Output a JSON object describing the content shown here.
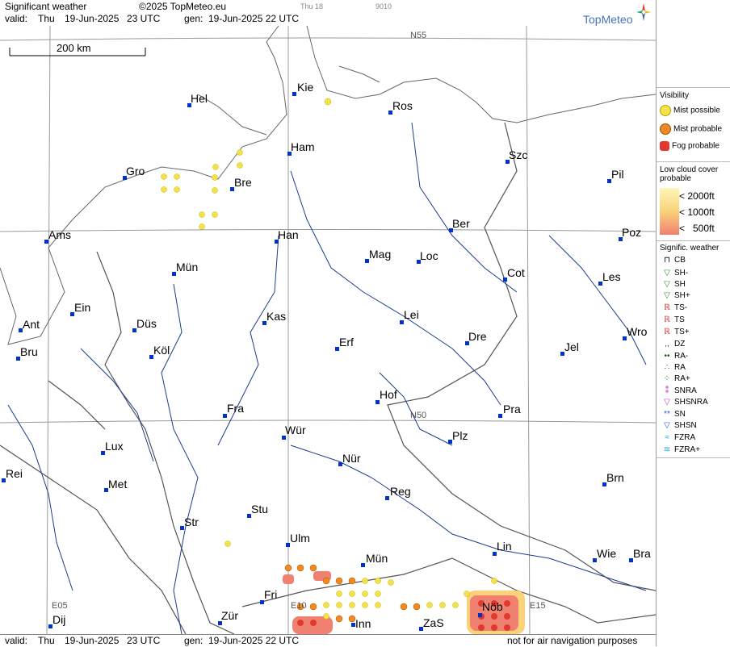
{
  "header": {
    "title": "Significant weather",
    "copyright": "©2025 TopMeteo.eu",
    "valid_label": "valid:",
    "valid_day": "Thu",
    "valid_date": "19-Jun-2025",
    "valid_time": "23 UTC",
    "gen_label": "gen:",
    "gen_value": "19-Jun-2025 22 UTC",
    "small_code_1": "Thu 18",
    "small_code_2": "9010",
    "brand": "TopMeteo"
  },
  "footer": {
    "valid_label": "valid:",
    "valid_day": "Thu",
    "valid_date": "19-Jun-2025",
    "valid_time": "23 UTC",
    "gen_label": "gen:",
    "gen_value": "19-Jun-2025 22 UTC",
    "disclaimer": "not for air navigation purposes"
  },
  "map": {
    "scale_label": "200 km",
    "grid_labels": {
      "n55": "N55",
      "n50": "N50",
      "e05": "E05",
      "e10": "E10",
      "e15": "E15"
    },
    "cities": [
      "Hel",
      "Kie",
      "Ros",
      "Ham",
      "Szc",
      "Gro",
      "Bre",
      "Pil",
      "Ber",
      "Ams",
      "Han",
      "Poz",
      "Mag",
      "Loc",
      "Mün",
      "Cot",
      "Les",
      "Ein",
      "Kas",
      "Lei",
      "Ant",
      "Düs",
      "Dre",
      "Wro",
      "Erf",
      "Köl",
      "Jel",
      "Bru",
      "Hof",
      "Fra",
      "Pra",
      "Lux",
      "Wür",
      "Plz",
      "Nür",
      "Rei",
      "Met",
      "Brn",
      "Reg",
      "Stu",
      "Str",
      "Lin",
      "Ulm",
      "Mün",
      "Wie",
      "Bra",
      "Fri",
      "Dij",
      "Zür",
      "Inn",
      "ZaS",
      "Nöb"
    ]
  },
  "legend": {
    "visibility_title": "Visibility",
    "mist_possible": "Mist possible",
    "mist_probable": "Mist probable",
    "fog_probable": "Fog probable",
    "low_cloud_title": "Low cloud cover probable",
    "lc_2000": "< 2000ft",
    "lc_1000": "< 1000ft",
    "lc_500": "<   500ft",
    "sig_title": "Signific. weather",
    "items": [
      "CB",
      "SH-",
      "SH",
      "SH+",
      "TS-",
      "TS",
      "TS+",
      "DZ",
      "RA-",
      "RA",
      "RA+",
      "SNRA",
      "SHSNRA",
      "SN",
      "SHSN",
      "FZRA",
      "FZRA+"
    ],
    "colors": {
      "mist_possible": "#f2e34a",
      "mist_probable": "#f08a24",
      "fog_probable": "#e03a2e",
      "lc1": "#fdf7b8",
      "lc2": "#f9d27a",
      "lc3": "#f08070",
      "accent_blue": "#0033cc"
    }
  }
}
